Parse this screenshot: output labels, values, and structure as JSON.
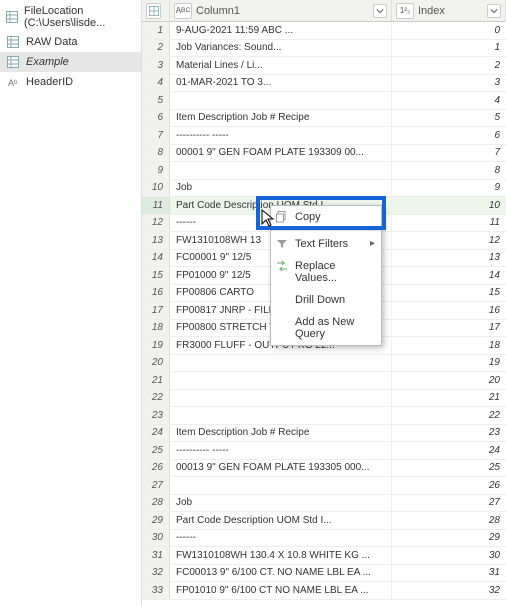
{
  "sidebar": {
    "items": [
      {
        "label": "FileLocation (C:\\Users\\lisde..."
      },
      {
        "label": "RAW Data"
      },
      {
        "label": "Example"
      },
      {
        "label": "HeaderID"
      }
    ],
    "selectedIndex": 2
  },
  "columns": {
    "rownum": "",
    "col1": {
      "type": "ABC",
      "label": "Column1"
    },
    "col2": {
      "type": "123",
      "label": "Index"
    }
  },
  "rows": [
    {
      "n": 1,
      "c1": "9-AUG-2021 11:59                          ABC ...",
      "c2": "0"
    },
    {
      "n": 2,
      "c1": "                              Job Variances: Sound...",
      "c2": "1"
    },
    {
      "n": 3,
      "c1": "                              Material Lines / Li...",
      "c2": "2"
    },
    {
      "n": 4,
      "c1": "                              01-MAR-2021 TO 3...",
      "c2": "3"
    },
    {
      "n": 5,
      "c1": "",
      "c2": "4"
    },
    {
      "n": 6,
      "c1": "Item        Description         Job #  Recipe",
      "c2": "5"
    },
    {
      "n": 7,
      "c1": "----------  -----",
      "c2": "6"
    },
    {
      "n": 8,
      "c1": "00001    9\" GEN FOAM PLATE       193309 00...",
      "c2": "7"
    },
    {
      "n": 9,
      "c1": "",
      "c2": "8"
    },
    {
      "n": 10,
      "c1": "                                  Job",
      "c2": "9"
    },
    {
      "n": 11,
      "c1": "   Part Code    Description      UOM    Std I...",
      "c2": "10",
      "sel": true
    },
    {
      "n": 12,
      "c1": "   ------",
      "c2": "11"
    },
    {
      "n": 13,
      "c1": "   FW1310108WH  13",
      "c2": "12"
    },
    {
      "n": 14,
      "c1": "   FC00001   9\" 12/5",
      "c2": "13"
    },
    {
      "n": 15,
      "c1": "   FP01000   9\" 12/5",
      "c2": "14"
    },
    {
      "n": 16,
      "c1": "   FP00806   CARTO",
      "c2": "15"
    },
    {
      "n": 17,
      "c1": "   FP00817   JNRP - FILM WHITE    EA",
      "c2": "16"
    },
    {
      "n": 18,
      "c1": "   FP00800   STRETCH WRAP FOR AUTOMATI",
      "c2": "17"
    },
    {
      "n": 19,
      "c1": "   FR3000    FLUFF - OUTPUT       KG    22...",
      "c2": "18"
    },
    {
      "n": 20,
      "c1": "",
      "c2": "19"
    },
    {
      "n": 21,
      "c1": "",
      "c2": "20"
    },
    {
      "n": 22,
      "c1": "",
      "c2": "21"
    },
    {
      "n": 23,
      "c1": "",
      "c2": "22"
    },
    {
      "n": 24,
      "c1": "Item        Description         Job #  Recipe",
      "c2": "23"
    },
    {
      "n": 25,
      "c1": "----------  -----",
      "c2": "24"
    },
    {
      "n": 26,
      "c1": "00013    9\" GEN FOAM PLATE       193305 000...",
      "c2": "25"
    },
    {
      "n": 27,
      "c1": "",
      "c2": "26"
    },
    {
      "n": 28,
      "c1": "                                  Job",
      "c2": "27"
    },
    {
      "n": 29,
      "c1": "   Part Code    Description      UOM    Std I...",
      "c2": "28"
    },
    {
      "n": 30,
      "c1": "   ------",
      "c2": "29"
    },
    {
      "n": 31,
      "c1": "   FW1310108WH  130.4 X 10.8    WHITE KG ...",
      "c2": "30"
    },
    {
      "n": 32,
      "c1": "   FC00013   9\" 6/100 CT. NO NAME LBL  EA  ...",
      "c2": "31"
    },
    {
      "n": 33,
      "c1": "   FP01010   9\" 6/100 CT NO NAME LBL  EA   ...",
      "c2": "32"
    }
  ],
  "context_menu": {
    "items": [
      {
        "label": "Copy"
      },
      {
        "label": "Text Filters",
        "submenu": true,
        "sep_before": true
      },
      {
        "label": "Replace Values...",
        "icon": "replace"
      },
      {
        "label": "Drill Down"
      },
      {
        "label": "Add as New Query"
      }
    ]
  }
}
